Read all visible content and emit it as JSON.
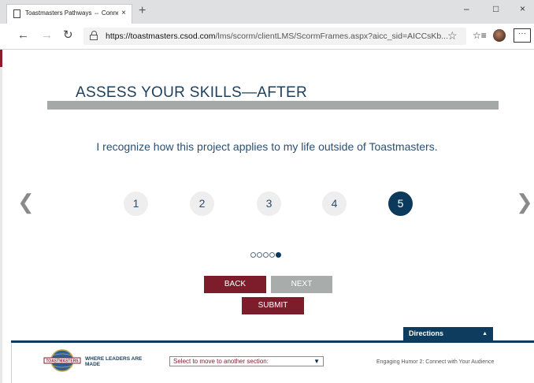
{
  "browser": {
    "tab_title": "Toastmasters Pathways ⇔ Connec",
    "tab_close": "×",
    "new_tab": "+",
    "minimize": "–",
    "maximize": "□",
    "close": "×",
    "back": "←",
    "forward": "→",
    "refresh": "↻",
    "url_domain": "https://toastmasters.csod.com",
    "url_path": "/lms/scorm/clientLMS/ScormFrames.aspx?aicc_sid=AICCsKb...",
    "favorite": "☆",
    "favorites_bar": "☆≡",
    "more": "···"
  },
  "slide": {
    "title": "ASSESS YOUR SKILLS—AFTER",
    "question": "I recognize how this project applies to my life outside of Toastmasters.",
    "prev_arrow": "❮",
    "next_arrow": "❯",
    "ratings": [
      "1",
      "2",
      "3",
      "4",
      "5"
    ],
    "selected_rating": 5,
    "progress": {
      "total": 5,
      "current": 5
    }
  },
  "buttons": {
    "back": "BACK",
    "next": "NEXT",
    "submit": "SUBMIT"
  },
  "directions": {
    "label": "Directions",
    "caret": "▲"
  },
  "footer": {
    "logo_text": "TOASTMASTERS",
    "tagline": "WHERE LEADERS ARE MADE",
    "section_select": "Select to move to another section:",
    "select_caret": "▼",
    "course_title": "Engaging Humor 2: Connect with Your Audience"
  },
  "colors": {
    "navy": "#0b3a5c",
    "maroon": "#7d1d2c",
    "gray": "#a8acab"
  }
}
